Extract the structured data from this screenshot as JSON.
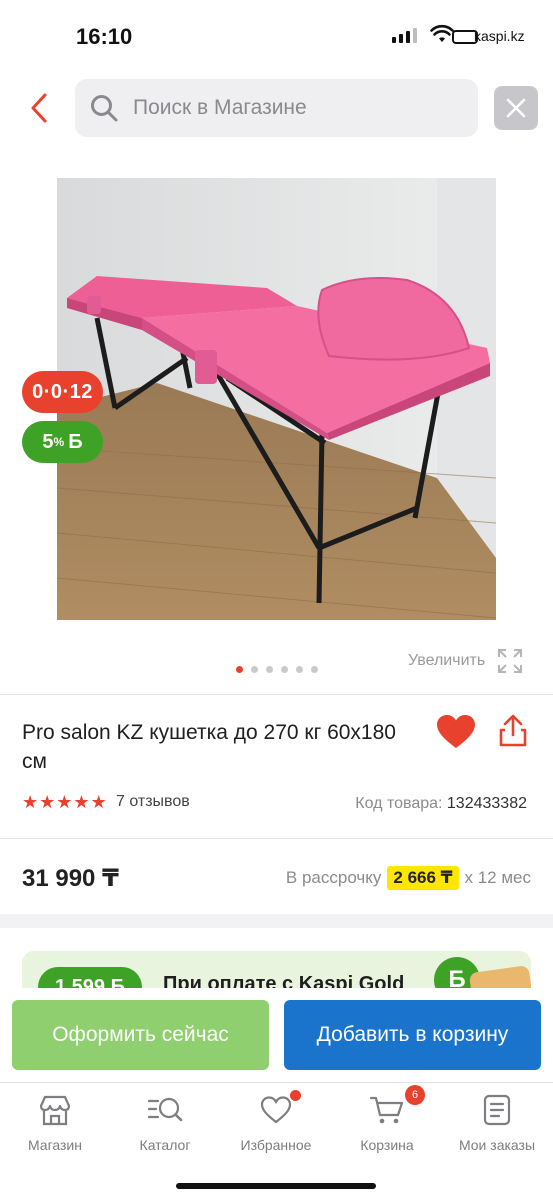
{
  "status_bar": {
    "time": "16:10",
    "carrier_badge": "kaspi.kz",
    "battery_level": "4"
  },
  "search": {
    "placeholder": "Поиск в Магазине"
  },
  "badges": {
    "installment": "0·0·12",
    "bonus_percent": "5",
    "bonus_sup": "%",
    "bonus_symbol": "Б"
  },
  "gallery": {
    "zoom_label": "Увеличить",
    "images_count": 6,
    "active_index": 0
  },
  "product": {
    "title": "Pro salon KZ кушетка до 270 кг 60x180 см",
    "rating": 5,
    "reviews": "7 отзывов",
    "sku_label": "Код товара:",
    "sku": "132433382",
    "price": "31 990 ₸",
    "installment_label": "В рассрочку",
    "installment_amount": "2 666 ₸",
    "installment_term": "х 12 мес",
    "favorite": true
  },
  "promo": {
    "bonus_chip": "1 599 Б",
    "text": "При оплате с Kaspi Gold",
    "coin": "Б"
  },
  "actions": {
    "buy_now": "Оформить сейчас",
    "add_to_cart": "Добавить в корзину"
  },
  "nav": {
    "items": [
      {
        "label": "Магазин",
        "icon": "store-icon"
      },
      {
        "label": "Каталог",
        "icon": "catalog-search-icon"
      },
      {
        "label": "Избранное",
        "icon": "heart-outline-icon"
      },
      {
        "label": "Корзина",
        "icon": "cart-icon"
      },
      {
        "label": "Мои заказы",
        "icon": "orders-icon"
      }
    ],
    "cart_count": "6"
  },
  "colors": {
    "accent_red": "#e8412e",
    "bonus_green": "#3ea226",
    "buy_now_green": "#8fcf6f",
    "cart_blue": "#1b74cc",
    "installment_yellow": "#ffe600",
    "product_pink": "#f0649a"
  }
}
